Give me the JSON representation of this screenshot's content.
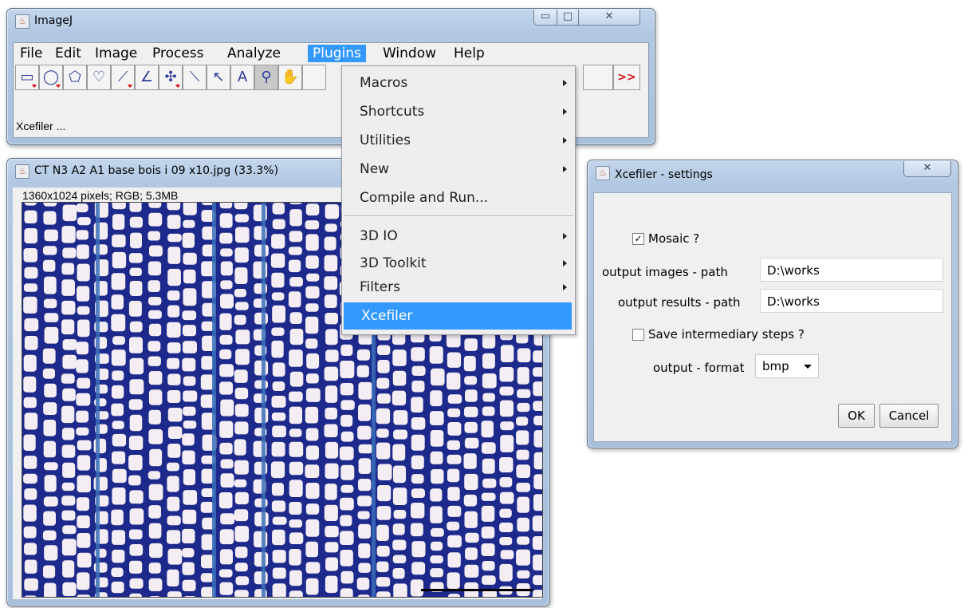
{
  "imagej_window": {
    "title": "ImageJ",
    "menus": [
      "File",
      "Edit",
      "Image",
      "Process",
      "Analyze",
      "Plugins",
      "Window",
      "Help"
    ],
    "active_menu": "Plugins",
    "status_text": "Xcefiler ...",
    "more_tools_label": ">>"
  },
  "plugins_menu": {
    "items": [
      {
        "label": "Macros",
        "submenu": true
      },
      {
        "label": "Shortcuts",
        "submenu": true
      },
      {
        "label": "Utilities",
        "submenu": true
      },
      {
        "label": "New",
        "submenu": true
      },
      {
        "label": "Compile and Run...",
        "submenu": false
      },
      {
        "label": "3D IO",
        "submenu": true
      },
      {
        "label": "3D Toolkit",
        "submenu": true
      },
      {
        "label": "Filters",
        "submenu": true
      },
      {
        "label": "Xcefiler",
        "submenu": false,
        "highlighted": true
      }
    ]
  },
  "image_window": {
    "title": "CT N3 A2 A1 base bois i 09 x10.jpg (33.3%)",
    "info": "1360x1024 pixels; RGB; 5.3MB"
  },
  "settings_dialog": {
    "title": "Xcefiler - settings",
    "mosaic_label": "Mosaic ?",
    "mosaic_checked": true,
    "output_images_label": "output images  - path",
    "output_images_value": "D:\\works",
    "output_results_label": "output results - path",
    "output_results_value": "D:\\works",
    "save_steps_label": "Save intermediary steps ?",
    "save_steps_checked": false,
    "format_label": "output - format",
    "format_value": "bmp",
    "ok_label": "OK",
    "cancel_label": "Cancel"
  },
  "icons": {
    "app_icon": "java-cup-icon",
    "close_icon": "close-icon",
    "minimize_icon": "minimize-icon",
    "maximize_icon": "maximize-icon"
  },
  "colors": {
    "menu_highlight": "#3399ff",
    "window_frame": "#b2c8e2",
    "cell_wall": "#1d2a8c",
    "cell_lumen": "#f4edf4"
  }
}
